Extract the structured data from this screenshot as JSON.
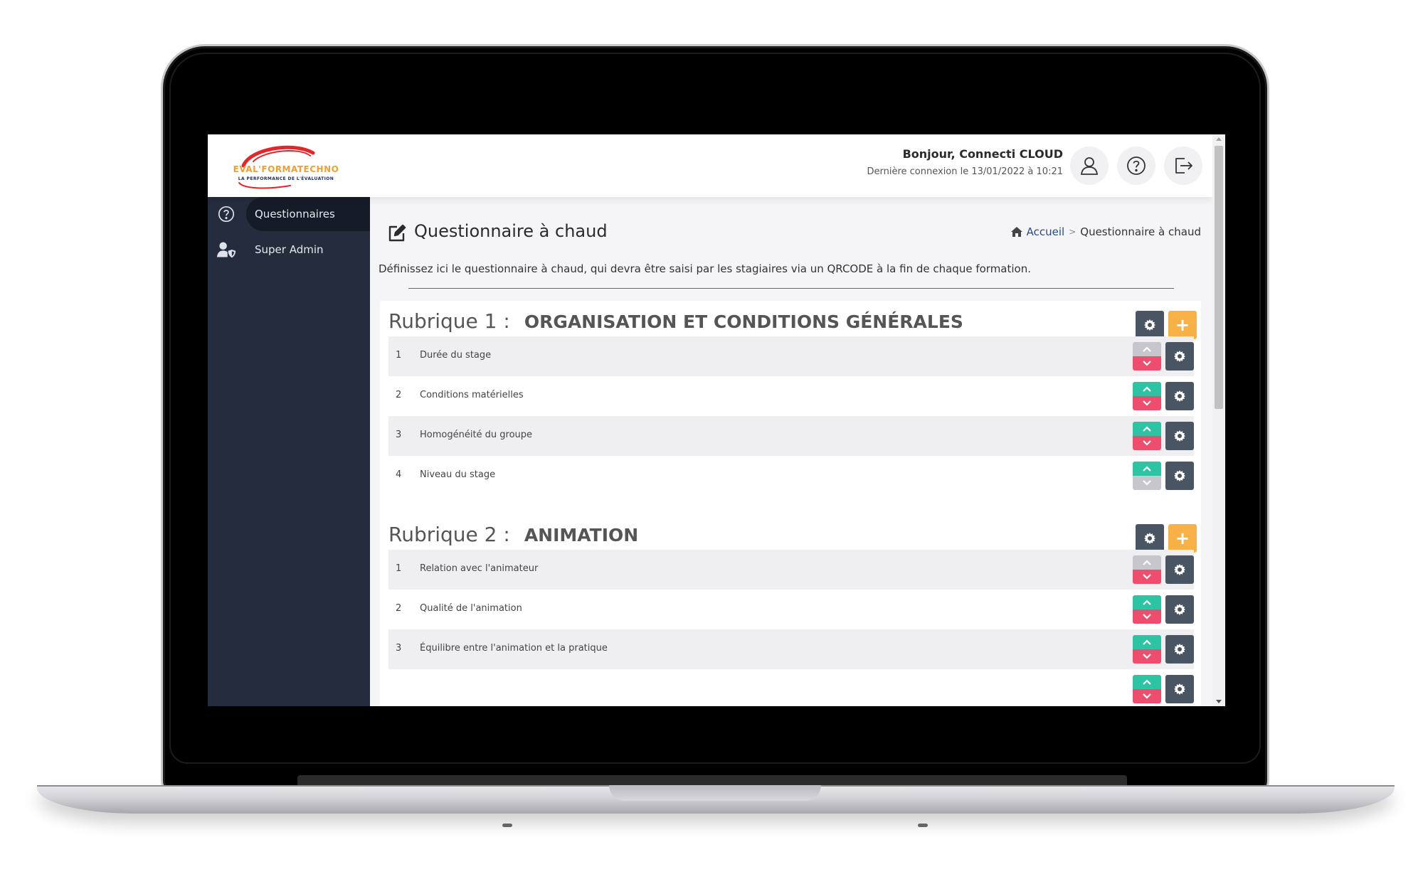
{
  "header": {
    "logo_text": "EVAL'FORMATECHNO",
    "logo_sub": "LA PERFORMANCE DE L'ÉVALUATION",
    "greeting": "Bonjour, Connecti CLOUD",
    "last_login": "Dernière connexion le 13/01/2022 à 10:21",
    "icons": [
      "user-icon",
      "help-icon",
      "logout-icon"
    ]
  },
  "sidebar": {
    "items": [
      {
        "label": "Questionnaires",
        "icon": "question-circle-icon",
        "active": true
      },
      {
        "label": "Super Admin",
        "icon": "user-shield-icon",
        "active": false
      }
    ]
  },
  "page": {
    "title": "Questionnaire à chaud",
    "breadcrumb_home": "Accueil",
    "breadcrumb_sep": ">",
    "breadcrumb_current": "Questionnaire à chaud",
    "intro": "Définissez ici le questionnaire à chaud, qui devra être saisi par les stagiaires via un QRCODE à la fin de chaque formation."
  },
  "rubriques": [
    {
      "label": "Rubrique 1 :",
      "name": "ORGANISATION ET CONDITIONS GÉNÉRALES",
      "add_label": "+",
      "items": [
        {
          "num": "1",
          "label": "Durée du stage"
        },
        {
          "num": "2",
          "label": "Conditions matérielles"
        },
        {
          "num": "3",
          "label": "Homogénéité du groupe"
        },
        {
          "num": "4",
          "label": "Niveau du stage"
        }
      ]
    },
    {
      "label": "Rubrique 2 :",
      "name": "ANIMATION",
      "add_label": "+",
      "items": [
        {
          "num": "1",
          "label": "Relation avec l'animateur"
        },
        {
          "num": "2",
          "label": "Qualité de l'animation"
        },
        {
          "num": "3",
          "label": "Équilibre entre l'animation et la pratique"
        }
      ]
    }
  ],
  "colors": {
    "sidebar": "#252c3e",
    "button_dark": "#4a5564",
    "button_add": "#f7b147",
    "arrow_up": "#2dc3a3",
    "arrow_down": "#ef4d6d",
    "arrow_disabled": "#c6c6cc"
  }
}
